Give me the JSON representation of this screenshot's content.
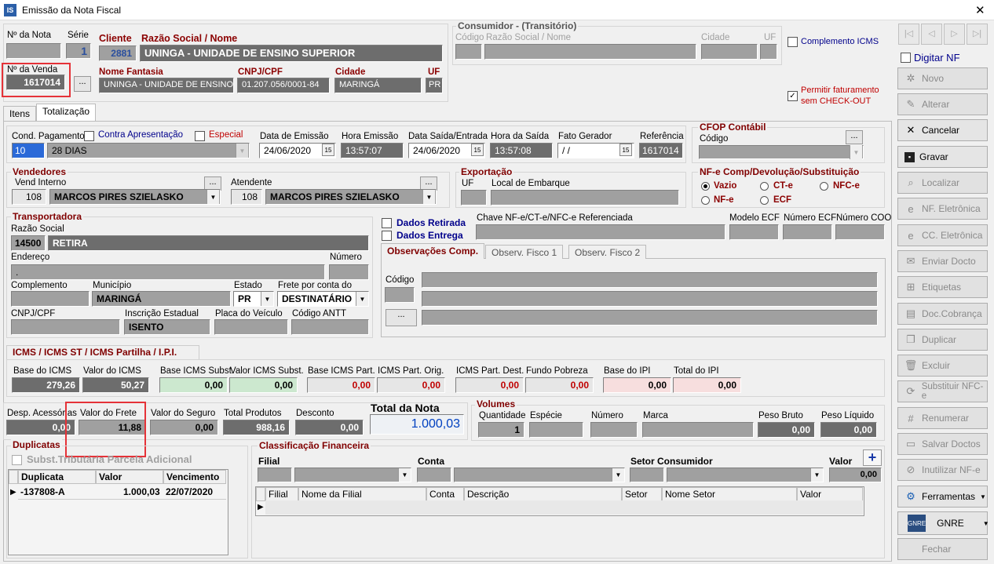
{
  "window": {
    "title": "Emissão da Nota Fiscal",
    "close": "✕"
  },
  "header": {
    "num_nota_label": "Nº da Nota",
    "serie_label": "Série",
    "serie_value": "1",
    "num_venda_label": "Nº da Venda",
    "num_venda_value": "1617014",
    "cliente_label": "Cliente",
    "cliente_code": "2881",
    "razao_label": "Razão Social / Nome",
    "razao_value": "UNINGA - UNIDADE DE ENSINO SUPERIOR",
    "fantasia_label": "Nome Fantasia",
    "fantasia_value": "UNINGA - UNIDADE DE ENSINO SU",
    "cnpj_label": "CNPJ/CPF",
    "cnpj_value": "01.207.056/0001-84",
    "cidade_label": "Cidade",
    "cidade_value": "MARINGÁ",
    "uf_label": "UF",
    "uf_value": "PR"
  },
  "consumidor": {
    "title": "Consumidor - (Transitório)",
    "codigo": "Código",
    "razao": "Razão Social / Nome",
    "cidade": "Cidade",
    "uf": "UF"
  },
  "complemento_icms": "Complemento ICMS",
  "permitir": "Permitir faturamento sem CHECK-OUT",
  "tabs": [
    "Itens",
    "Totalização"
  ],
  "cond": {
    "label": "Cond. Pagamento",
    "code": "10",
    "value": "28 DIAS",
    "contra": "Contra Apresentação",
    "especial": "Especial"
  },
  "datas": {
    "emissao_label": "Data de Emissão",
    "emissao": "24/06/2020",
    "hora_emissao_label": "Hora Emissão",
    "hora_emissao": "13:57:07",
    "saida_label": "Data Saída/Entrada",
    "saida": "24/06/2020",
    "hora_saida_label": "Hora da Saída",
    "hora_saida": "13:57:08",
    "fato_label": "Fato Gerador",
    "fato": " /  /",
    "ref_label": "Referência",
    "ref": "1617014"
  },
  "cfop": {
    "title": "CFOP Contábil",
    "codigo": "Código"
  },
  "vendedores": {
    "title": "Vendedores",
    "vend_label": "Vend Interno",
    "vend_code": "108",
    "vend_name": "MARCOS PIRES SZIELASKO",
    "atend_label": "Atendente",
    "atend_code": "108",
    "atend_name": "MARCOS PIRES SZIELASKO"
  },
  "exportacao": {
    "title": "Exportação",
    "uf": "UF",
    "local": "Local de Embarque"
  },
  "nfe_comp": {
    "title": "NF-e Comp/Devolução/Substituição",
    "options": [
      "Vazio",
      "CT-e",
      "NFC-e",
      "NF-e",
      "ECF"
    ]
  },
  "transp": {
    "title": "Transportadora",
    "razao_label": "Razão Social",
    "code": "14500",
    "name": "RETIRA",
    "endereco_label": "Endereço",
    "endereco": ".",
    "numero_label": "Número",
    "compl_label": "Complemento",
    "mun_label": "Município",
    "mun": "MARINGÁ",
    "estado_label": "Estado",
    "estado": "PR",
    "frete_label": "Frete por conta do",
    "frete": "DESTINATÁRIO",
    "cnpj_label": "CNPJ/CPF",
    "ie_label": "Inscrição Estadual",
    "ie": "ISENTO",
    "placa_label": "Placa do Veículo",
    "antt_label": "Código ANTT"
  },
  "dados_retirada": "Dados Retirada",
  "dados_entrega": "Dados Entrega",
  "chave": {
    "chave": "Chave NF-e/CT-e/NFC-e Referenciada",
    "modelo": "Modelo ECF",
    "numero": "Número ECF",
    "coo": "Número COO"
  },
  "obs_tabs": [
    "Observações Comp.",
    "Observ. Fisco 1",
    "Observ. Fisco 2"
  ],
  "obs_codigo": "Código",
  "icms": {
    "title": "ICMS / ICMS ST / ICMS Partilha / I.P.I.",
    "base_label": "Base do ICMS",
    "base": "279,26",
    "valor_label": "Valor do ICMS",
    "valor": "50,27",
    "base_st_label": "Base ICMS Subst.",
    "base_st": "0,00",
    "valor_st_label": "Valor ICMS Subst.",
    "valor_st": "0,00",
    "base_part_label": "Base ICMS Part.",
    "base_part": "0,00",
    "part_orig_label": "ICMS Part. Orig.",
    "part_orig": "0,00",
    "part_dest_label": "ICMS Part. Dest.",
    "part_dest": "0,00",
    "pobreza_label": "Fundo Pobreza",
    "pobreza": "0,00",
    "base_ipi_label": "Base do IPI",
    "base_ipi": "0,00",
    "total_ipi_label": "Total do IPI",
    "total_ipi": "0,00"
  },
  "totais": {
    "desp_label": "Desp. Acessórias",
    "desp": "0,00",
    "frete_label": "Valor do Frete",
    "frete": "11,88",
    "seguro_label": "Valor do Seguro",
    "seguro": "0,00",
    "prod_label": "Total Produtos",
    "prod": "988,16",
    "desc_label": "Desconto",
    "desc": "0,00",
    "total_label": "Total da Nota",
    "total": "1.000,03"
  },
  "volumes": {
    "title": "Volumes",
    "qtd_label": "Quantidade",
    "qtd": "1",
    "especie": "Espécie",
    "numero": "Número",
    "marca": "Marca",
    "bruto_label": "Peso Bruto",
    "bruto": "0,00",
    "liquido_label": "Peso Líquido",
    "liquido": "0,00"
  },
  "duplicatas": {
    "title": "Duplicatas",
    "subst": "Subst.Tributária Parcela Adicional",
    "cols": [
      "Duplicata",
      "Valor",
      "Vencimento"
    ],
    "row": [
      "-137808-A",
      "1.000,03",
      "22/07/2020"
    ]
  },
  "classif": {
    "title": "Classificação Financeira",
    "filial": "Filial",
    "conta": "Conta",
    "setor": "Setor Consumidor",
    "valor": "Valor",
    "valor_val": "0,00",
    "cols": [
      "Filial",
      "Nome da Filial",
      "Conta",
      "Descrição",
      "Setor",
      "Nome Setor",
      "Valor"
    ]
  },
  "sidebar": {
    "digitar": "Digitar NF",
    "buttons": [
      "Novo",
      "Alterar",
      "Cancelar",
      "Gravar",
      "Localizar",
      "NF. Eletrônica",
      "CC. Eletrônica",
      "Enviar Docto",
      "Etiquetas",
      "Doc.Cobrança",
      "Duplicar",
      "Excluir",
      "Substituir NFC-e",
      "Renumerar",
      "Salvar Doctos",
      "Inutilizar NF-e",
      "Ferramentas",
      "GNRE",
      "Fechar"
    ]
  }
}
